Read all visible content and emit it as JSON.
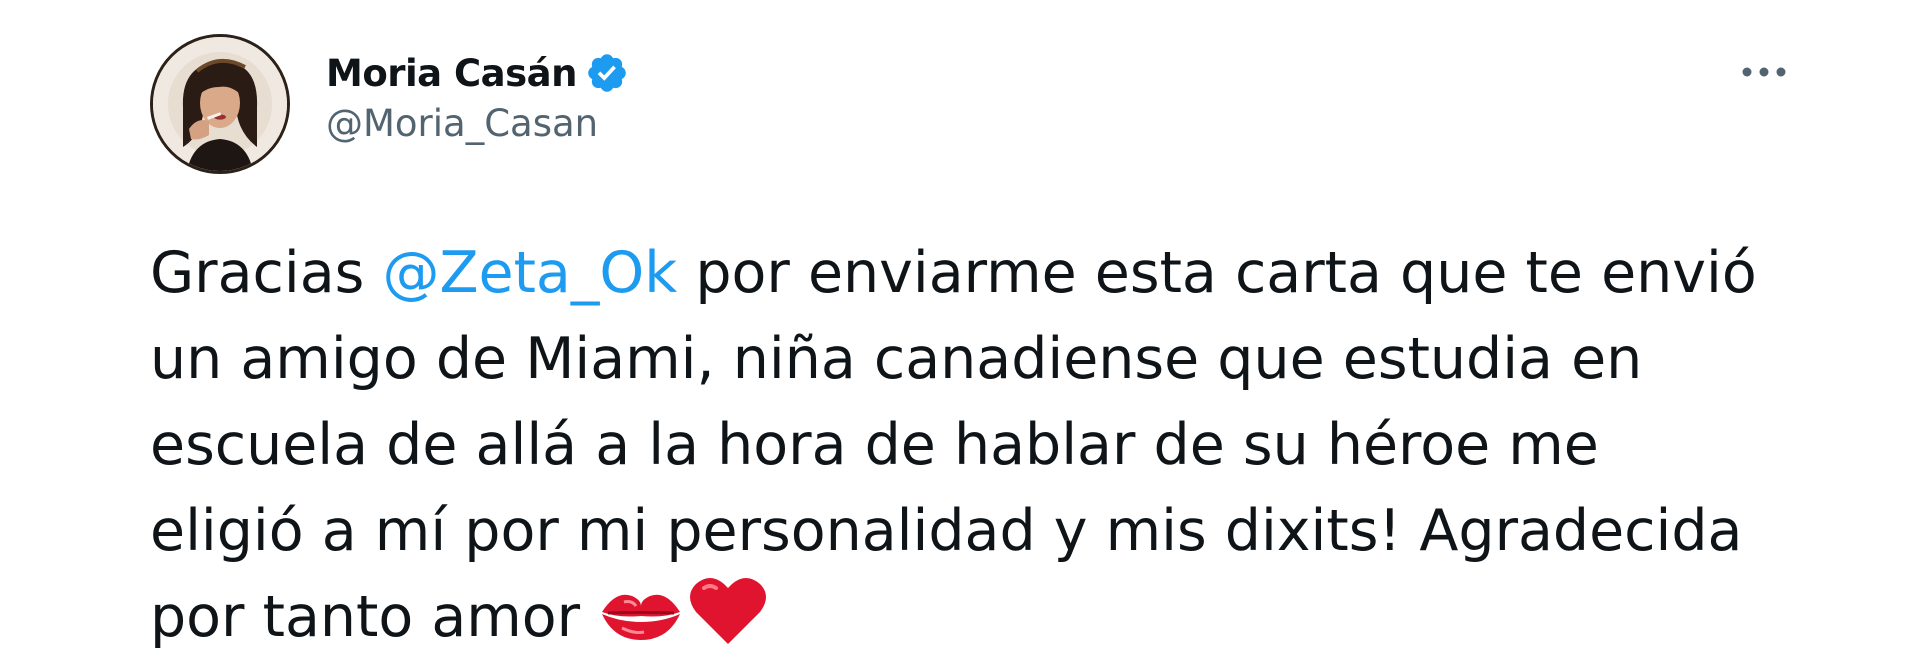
{
  "author": {
    "display_name": "Moria Casán",
    "handle": "@Moria_Casan",
    "verified": true,
    "avatar_icon": "profile-photo"
  },
  "menu": {
    "more_icon": "more-horizontal-icon"
  },
  "tweet": {
    "line1_before": "Gracias ",
    "mention": "@Zeta_Ok",
    "line1_after": " por enviarme esta carta que te envió",
    "line2": "un amigo de Miami, niña canadiense que estudia en",
    "line3": "escuela de allá a la hora de hablar de su héroe me",
    "line4": "eligió a mí por mi personalidad y mis dixits! Agradecida",
    "line5": "por tanto amor",
    "emojis": [
      "kiss-mark-icon",
      "red-heart-icon"
    ]
  },
  "colors": {
    "accent": "#1d9bf0",
    "text": "#0f1419",
    "muted": "#536471",
    "heart": "#e0142f"
  }
}
